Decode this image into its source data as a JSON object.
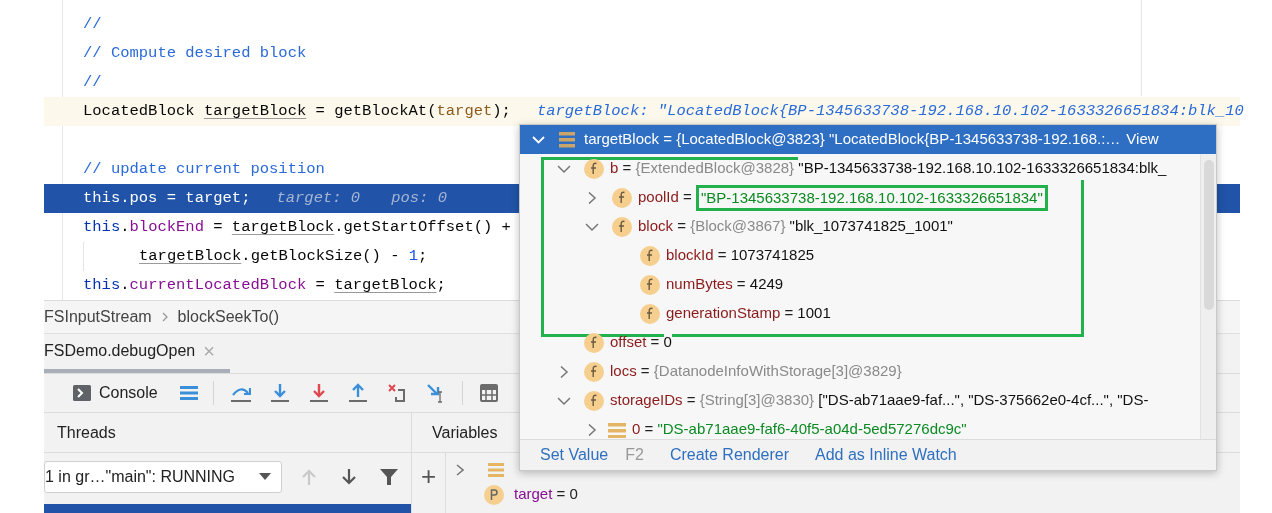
{
  "editor": {
    "lines": [
      {
        "kind": "code",
        "tokens": [
          {
            "kind": "comment",
            "text": "//"
          }
        ]
      },
      {
        "kind": "code",
        "tokens": [
          {
            "kind": "comment",
            "text": "// Compute desired block"
          }
        ]
      },
      {
        "kind": "code",
        "tokens": [
          {
            "kind": "comment",
            "text": "//"
          }
        ]
      },
      {
        "kind": "code",
        "caret_line": true,
        "tokens": [
          {
            "kind": "plain",
            "text": "LocatedBlock "
          },
          {
            "kind": "ref",
            "text": "targetBlock"
          },
          {
            "kind": "plain",
            "text": " = getBlockAt("
          },
          {
            "kind": "param",
            "text": "target"
          },
          {
            "kind": "plain",
            "text": ");"
          }
        ],
        "hints": [
          "targetBlock: \"LocatedBlock{BP-1345633738-192.168.10.102-1633326651834:blk_10"
        ]
      },
      {
        "kind": "blank"
      },
      {
        "kind": "code",
        "tokens": [
          {
            "kind": "comment",
            "text": "// update current position"
          }
        ]
      },
      {
        "kind": "code",
        "execution_point": true,
        "tokens": [
          {
            "kind": "kw",
            "text": "this"
          },
          {
            "kind": "plain",
            "text": ".pos = target;"
          }
        ],
        "hints": [
          "target: 0",
          "pos: 0"
        ]
      },
      {
        "kind": "code",
        "tokens": [
          {
            "kind": "kw",
            "text": "this"
          },
          {
            "kind": "plain",
            "text": "."
          },
          {
            "kind": "field",
            "text": "blockEnd"
          },
          {
            "kind": "plain",
            "text": " = "
          },
          {
            "kind": "ref",
            "text": "targetBlock"
          },
          {
            "kind": "plain",
            "text": ".getStartOffset() +"
          }
        ]
      },
      {
        "kind": "code",
        "continuation": true,
        "tokens": [
          {
            "kind": "ref",
            "text": "targetBlock"
          },
          {
            "kind": "plain",
            "text": ".getBlockSize() - "
          },
          {
            "kind": "num",
            "text": "1"
          },
          {
            "kind": "plain",
            "text": ";"
          }
        ]
      },
      {
        "kind": "code",
        "tokens": [
          {
            "kind": "kw",
            "text": "this"
          },
          {
            "kind": "plain",
            "text": "."
          },
          {
            "kind": "field",
            "text": "currentLocatedBlock"
          },
          {
            "kind": "plain",
            "text": " = "
          },
          {
            "kind": "ref",
            "text": "targetBlock"
          },
          {
            "kind": "plain",
            "text": ";"
          }
        ]
      }
    ]
  },
  "breadcrumbs": [
    "FSInputStream",
    "blockSeekTo()"
  ],
  "session_tab": {
    "label": "FSDemo.debugOpen",
    "close": "×",
    "selected": true
  },
  "toolbar": {
    "console_label": "Console"
  },
  "threads": {
    "header": "Threads",
    "dropdown": "1 in gr…\"main\": RUNNING",
    "controls": [
      {
        "kind": "prev",
        "disabled": true
      },
      {
        "kind": "next",
        "disabled": false
      },
      {
        "kind": "filter",
        "disabled": false
      }
    ]
  },
  "variables": {
    "header": "Variables",
    "add": "+",
    "rows": [
      {
        "kind": "object",
        "expanded": false
      },
      {
        "kind": "param",
        "name": "target",
        "op": "=",
        "value": "0"
      }
    ]
  },
  "popup": {
    "title": "targetBlock = {LocatedBlock@3823} \"LocatedBlock{BP-1345633738-192.168.:…",
    "view_link": "View",
    "expanded": true,
    "nodes": [
      {
        "kind": "field",
        "name": "b",
        "op": "=",
        "type": "{ExtendedBlock@3828}",
        "value": "\"BP-1345633738-192.168.10.102-1633326651834:blk_",
        "expanded": true,
        "children": [
          {
            "kind": "field",
            "name": "poolId",
            "op": "=",
            "value": "\"BP-1345633738-192.168.10.102-1633326651834\"",
            "string": true,
            "boxed": true,
            "expanded": false
          },
          {
            "kind": "field",
            "name": "block",
            "op": "=",
            "type": "{Block@3867}",
            "value": "\"blk_1073741825_1001\"",
            "expanded": true,
            "children": [
              {
                "kind": "field",
                "name": "blockId",
                "op": "=",
                "value": "1073741825"
              },
              {
                "kind": "field",
                "name": "numBytes",
                "op": "=",
                "value": "4249"
              },
              {
                "kind": "field",
                "name": "generationStamp",
                "op": "=",
                "value": "1001"
              }
            ]
          }
        ]
      },
      {
        "kind": "field",
        "name": "offset",
        "op": "=",
        "value": "0"
      },
      {
        "kind": "field",
        "name": "locs",
        "op": "=",
        "type": "{DatanodeInfoWithStorage[3]@3829}",
        "expanded": false
      },
      {
        "kind": "field",
        "name": "storageIDs",
        "op": "=",
        "type": "{String[3]@3830}",
        "value": "[\"DS-ab71aae9-faf...\", \"DS-375662e0-4cf...\", \"DS-",
        "expanded": true,
        "children": [
          {
            "kind": "item",
            "name": "0",
            "op": "=",
            "value": "\"DS-ab71aae9-faf6-40f5-a04d-5ed57276dc9c\"",
            "string": true,
            "expanded": false
          }
        ]
      }
    ],
    "actions": [
      {
        "label": "Set Value",
        "shortcut": "F2"
      },
      {
        "label": "Create Renderer"
      },
      {
        "label": "Add as Inline Watch"
      }
    ]
  }
}
